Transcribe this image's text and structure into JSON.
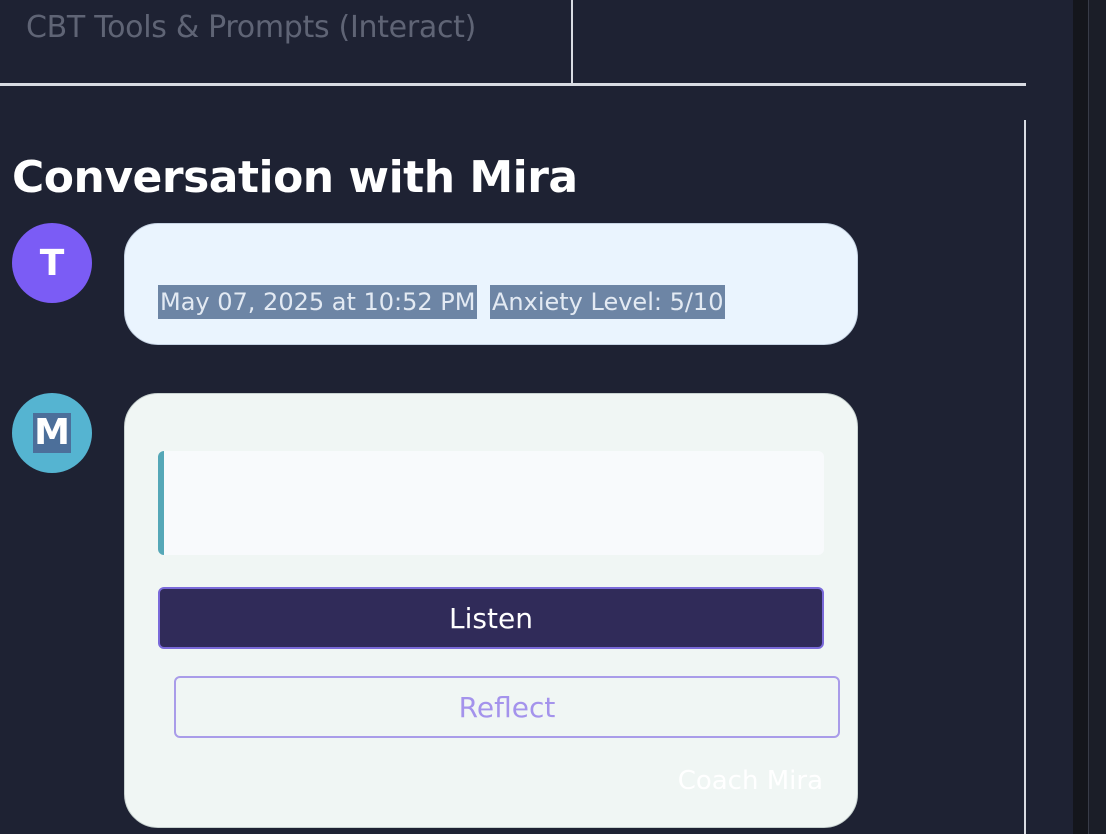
{
  "tabs": {
    "cbt_tools": "CBT Tools & Prompts (Interact)"
  },
  "conversation": {
    "title": "Conversation with Mira",
    "user_message": {
      "avatar_initial": "T",
      "date": "May 07, 2025 at 10:52 PM",
      "anxiety": "Anxiety Level: 5/10"
    },
    "assistant_message": {
      "avatar_initial": "M",
      "quote_text": "",
      "listen_label": "Listen",
      "reflect_label": "Reflect",
      "signature": "Coach Mira"
    }
  },
  "colors": {
    "background": "#1e2233",
    "user_avatar": "#7b5cf5",
    "assistant_avatar": "#55b4d1",
    "listen_button": "#302b59",
    "reflect_text": "#a493ec",
    "quote_accent": "#55a7b7"
  }
}
